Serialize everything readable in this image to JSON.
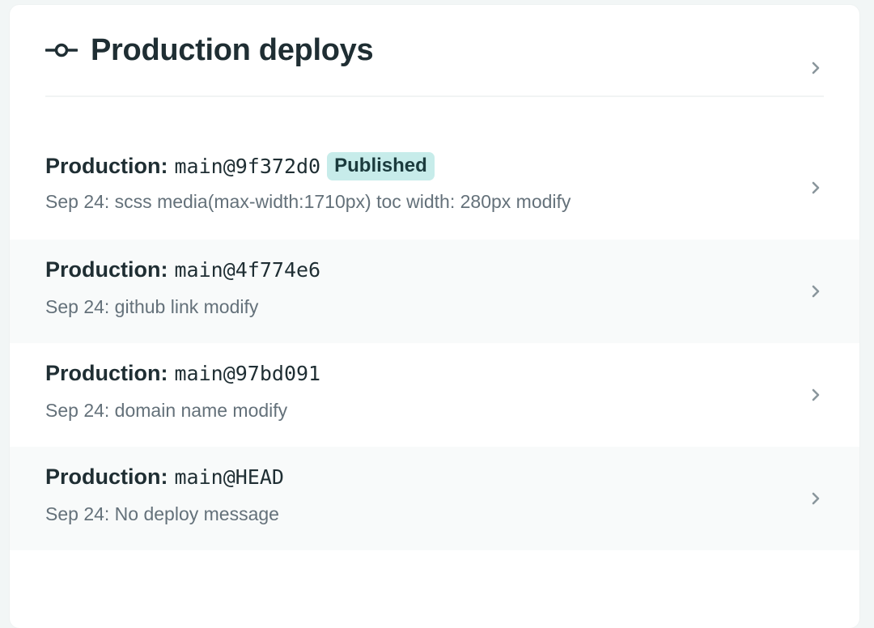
{
  "header": {
    "title": "Production deploys",
    "icon": "commit-icon",
    "chevron_icon": "chevron-right-icon"
  },
  "deploys": [
    {
      "env": "Production:",
      "ref": "main@9f372d0",
      "badge": "Published",
      "message": "Sep 24: scss media(max-width:1710px) toc width: 280px modify"
    },
    {
      "env": "Production:",
      "ref": "main@4f774e6",
      "badge": "",
      "message": "Sep 24: github link modify"
    },
    {
      "env": "Production:",
      "ref": "main@97bd091",
      "badge": "",
      "message": "Sep 24: domain name modify"
    },
    {
      "env": "Production:",
      "ref": "main@HEAD",
      "badge": "",
      "message": "Sep 24: No deploy message"
    }
  ],
  "colors": {
    "badge_bg": "#c7ecea",
    "title": "#1f2e33",
    "muted": "#64717a",
    "alt_row": "#f8fafa"
  }
}
